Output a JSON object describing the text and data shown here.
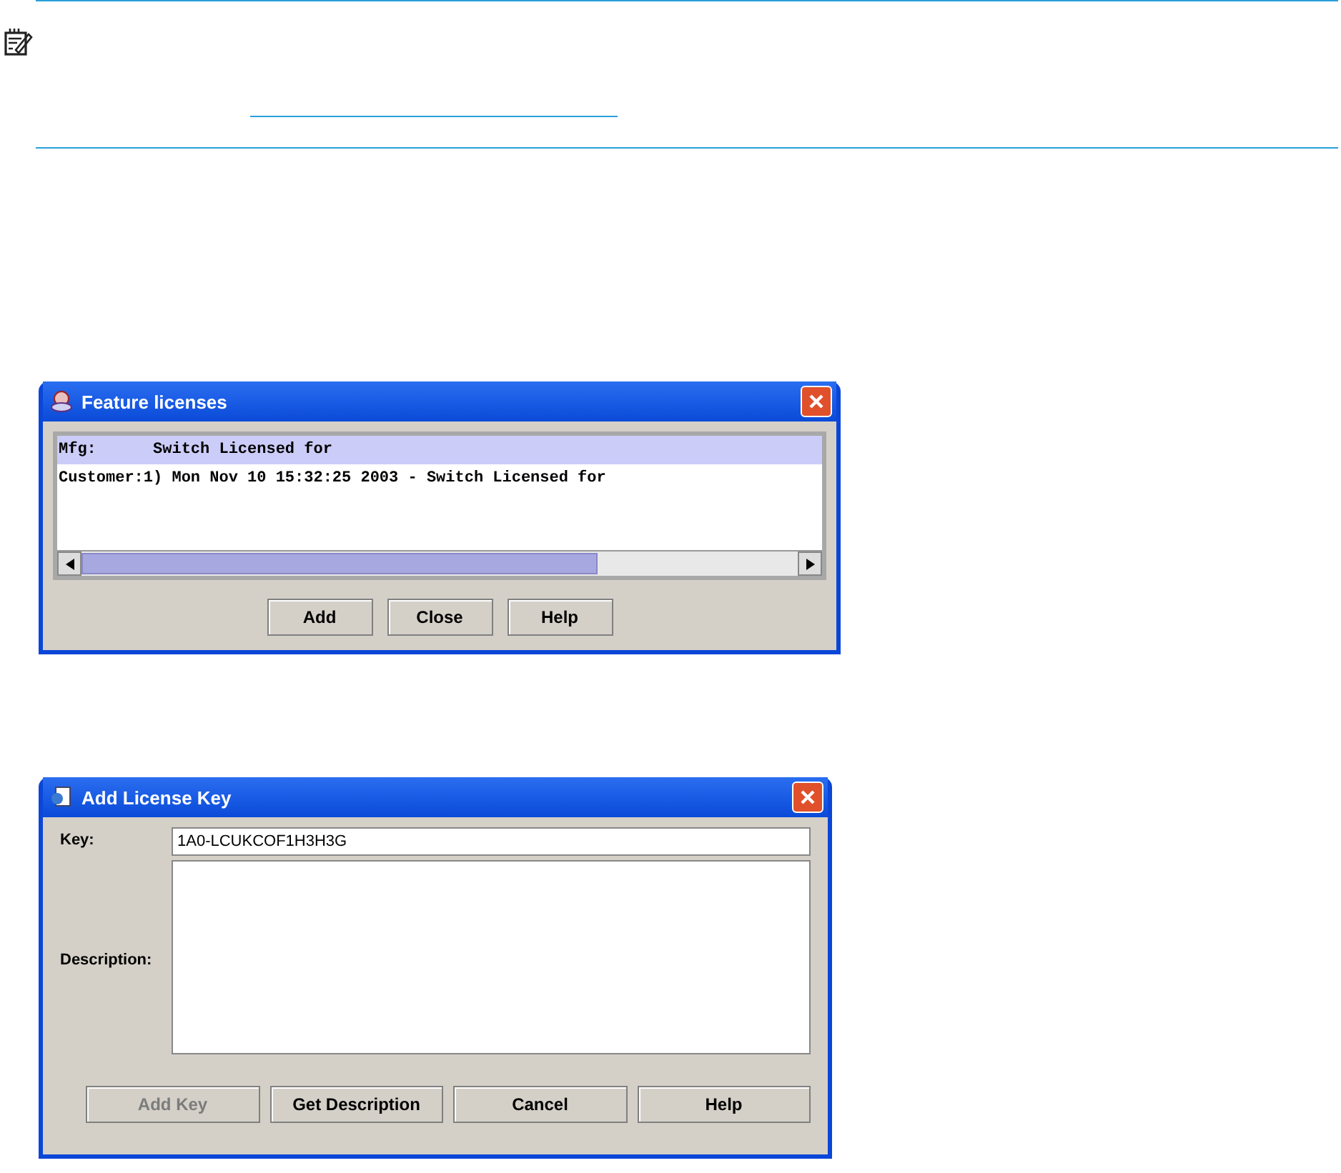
{
  "feature_dialog": {
    "title": "Feature licenses",
    "rows": [
      {
        "text": "Mfg:      Switch Licensed for",
        "selected": true
      },
      {
        "text": "Customer:1) Mon Nov 10 15:32:25 2003 - Switch Licensed for",
        "selected": false
      }
    ],
    "buttons": [
      {
        "label": "Add",
        "disabled": false
      },
      {
        "label": "Close",
        "disabled": false
      },
      {
        "label": "Help",
        "disabled": false
      }
    ]
  },
  "add_key_dialog": {
    "title": "Add License Key",
    "key_label": "Key:",
    "key_value": "1A0-LCUKCOF1H3H3G",
    "description_label": "Description:",
    "buttons": [
      {
        "label": "Add Key",
        "disabled": true
      },
      {
        "label": "Get Description",
        "disabled": false
      },
      {
        "label": "Cancel",
        "disabled": false
      },
      {
        "label": "Help",
        "disabled": false
      }
    ]
  }
}
